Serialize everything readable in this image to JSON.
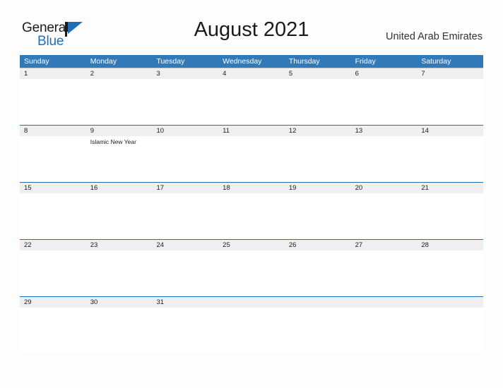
{
  "brand": {
    "name_part1": "General",
    "name_part2": "Blue",
    "logo_icon": "blue-flag-triangle-icon",
    "color_dark": "#1b1b1b",
    "color_blue": "#1f6fb8"
  },
  "header": {
    "title": "August 2021",
    "country": "United Arab Emirates"
  },
  "calendar": {
    "accent_color": "#3279b8",
    "row_strip_color": "#efefef",
    "weekdays": [
      "Sunday",
      "Monday",
      "Tuesday",
      "Wednesday",
      "Thursday",
      "Friday",
      "Saturday"
    ],
    "weeks": [
      {
        "days": [
          {
            "date": "1",
            "event": ""
          },
          {
            "date": "2",
            "event": ""
          },
          {
            "date": "3",
            "event": ""
          },
          {
            "date": "4",
            "event": ""
          },
          {
            "date": "5",
            "event": ""
          },
          {
            "date": "6",
            "event": ""
          },
          {
            "date": "7",
            "event": ""
          }
        ]
      },
      {
        "days": [
          {
            "date": "8",
            "event": ""
          },
          {
            "date": "9",
            "event": "Islamic New Year"
          },
          {
            "date": "10",
            "event": ""
          },
          {
            "date": "11",
            "event": ""
          },
          {
            "date": "12",
            "event": ""
          },
          {
            "date": "13",
            "event": ""
          },
          {
            "date": "14",
            "event": ""
          }
        ]
      },
      {
        "days": [
          {
            "date": "15",
            "event": ""
          },
          {
            "date": "16",
            "event": ""
          },
          {
            "date": "17",
            "event": ""
          },
          {
            "date": "18",
            "event": ""
          },
          {
            "date": "19",
            "event": ""
          },
          {
            "date": "20",
            "event": ""
          },
          {
            "date": "21",
            "event": ""
          }
        ]
      },
      {
        "days": [
          {
            "date": "22",
            "event": ""
          },
          {
            "date": "23",
            "event": ""
          },
          {
            "date": "24",
            "event": ""
          },
          {
            "date": "25",
            "event": ""
          },
          {
            "date": "26",
            "event": ""
          },
          {
            "date": "27",
            "event": ""
          },
          {
            "date": "28",
            "event": ""
          }
        ]
      },
      {
        "days": [
          {
            "date": "29",
            "event": ""
          },
          {
            "date": "30",
            "event": ""
          },
          {
            "date": "31",
            "event": ""
          },
          {
            "date": "",
            "event": ""
          },
          {
            "date": "",
            "event": ""
          },
          {
            "date": "",
            "event": ""
          },
          {
            "date": "",
            "event": ""
          }
        ]
      }
    ]
  }
}
